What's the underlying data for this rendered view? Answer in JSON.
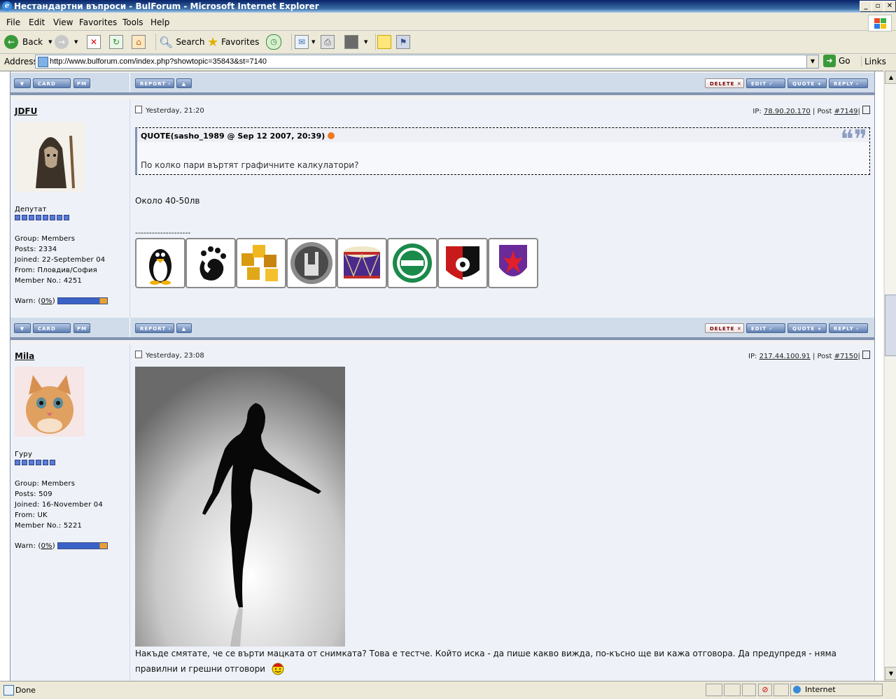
{
  "window": {
    "title": "Нестандартни въпроси - BulForum - Microsoft Internet Explorer"
  },
  "menu": [
    "File",
    "Edit",
    "View",
    "Favorites",
    "Tools",
    "Help"
  ],
  "toolbar": {
    "back": "Back",
    "search": "Search",
    "favorites": "Favorites"
  },
  "address": {
    "label": "Address",
    "url": "http://www.bulforum.com/index.php?showtopic=35843&st=7140",
    "go": "Go",
    "links": "Links"
  },
  "buttons": {
    "card": "CARD",
    "pm": "PM",
    "report": "REPORT",
    "delete": "DELETE",
    "edit": "EDIT",
    "quote": "QUOTE",
    "reply": "REPLY"
  },
  "posts": [
    {
      "author": "JDFU",
      "date": "Yesterday, 21:20",
      "ip_label": "IP:",
      "ip": "78.90.20.170",
      "post_label": "| Post",
      "post_num": "#7149",
      "rank": "Депутат",
      "group": "Group: Members",
      "posts": "Posts: 2334",
      "joined": "Joined: 22-September 04",
      "from": "From: Пловдив/София",
      "member_no": "Member No.: 4251",
      "warn_label": "Warn: (",
      "warn_value": "0%",
      "warn_close": ")",
      "quote_title": "QUOTE(sasho_1989 @ Sep 12 2007, 20:39)",
      "quote_text": "По колко пари въртят графичните калкулатори?",
      "body": "Около 40-50лв",
      "signature": "--------------------"
    },
    {
      "author": "Mila",
      "date": "Yesterday, 23:08",
      "ip_label": "IP:",
      "ip": "217.44.100.91",
      "post_label": "| Post",
      "post_num": "#7150",
      "rank": "Гуру",
      "group": "Group: Members",
      "posts": "Posts: 509",
      "joined": "Joined: 16-November 04",
      "from": "From: UK",
      "member_no": "Member No.: 5221",
      "warn_label": "Warn: (",
      "warn_value": "0%",
      "warn_close": ")",
      "body_line1": "Накъде смятате, че се върти мацката от снимката? Това е тестче. Който иска - да пише какво вижда, по-късно ще ви кажа отговора. Да предупредя - няма",
      "body_line2": "правилни и грешни отговори"
    }
  ],
  "status": {
    "text": "Done",
    "zone": "Internet"
  }
}
